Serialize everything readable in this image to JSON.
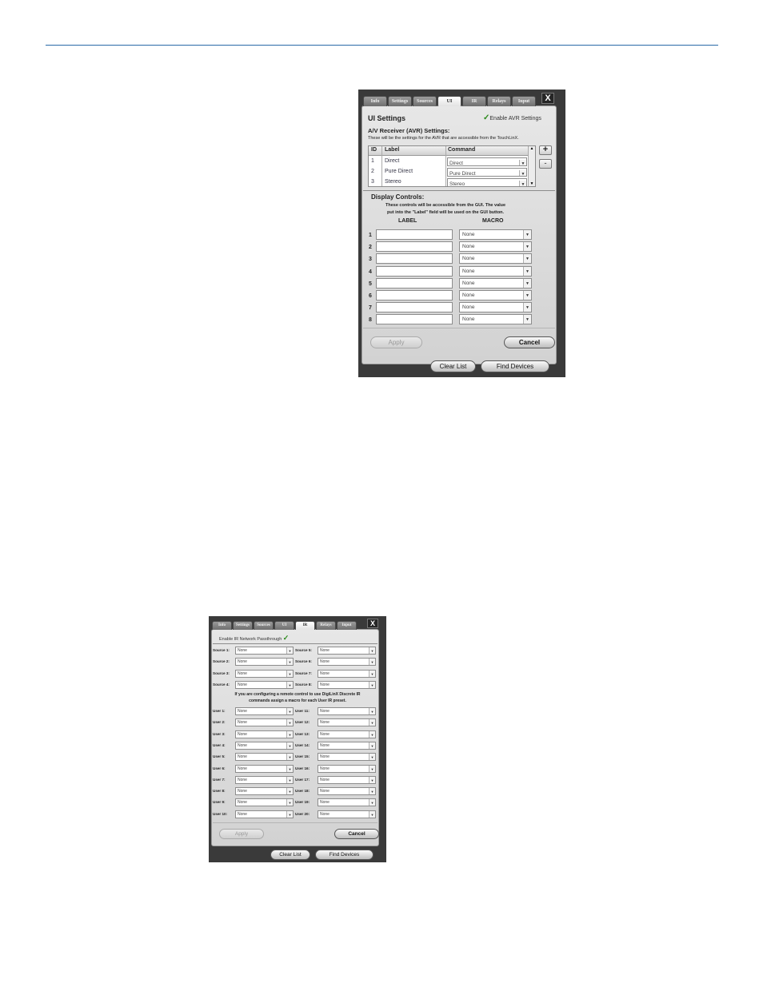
{
  "dialog1": {
    "tabs": [
      "Info",
      "Settings",
      "Sources",
      "UI",
      "IR",
      "Relays",
      "Input"
    ],
    "active_tab": "UI",
    "close": "X",
    "title": "UI Settings",
    "enable_avr": "Enable AVR Settings",
    "avr_heading": "A/V Receiver (AVR) Settings:",
    "avr_desc": "These will be the settings for the AVR that are accessible from the TouchLinX.",
    "columns": [
      "ID",
      "Label",
      "Command"
    ],
    "rows": [
      {
        "id": "1",
        "label": "Direct",
        "command": "Direct"
      },
      {
        "id": "2",
        "label": "Pure Direct",
        "command": "Pure Direct"
      },
      {
        "id": "3",
        "label": "Stereo",
        "command": "Stereo"
      }
    ],
    "add": "+",
    "remove": "-",
    "display_heading": "Display Controls:",
    "display_desc1": "These controls will be accessible from the GUI.  The value",
    "display_desc2": "put into the \"Label\" field will be used on the GUI button.",
    "label_col": "LABEL",
    "macro_col": "MACRO",
    "controls": [
      {
        "n": "1",
        "macro": "None"
      },
      {
        "n": "2",
        "macro": "None"
      },
      {
        "n": "3",
        "macro": "None"
      },
      {
        "n": "4",
        "macro": "None"
      },
      {
        "n": "5",
        "macro": "None"
      },
      {
        "n": "6",
        "macro": "None"
      },
      {
        "n": "7",
        "macro": "None"
      },
      {
        "n": "8",
        "macro": "None"
      }
    ],
    "apply": "Apply",
    "cancel": "Cancel",
    "clear_list": "Clear List",
    "find_devices": "Find Devices"
  },
  "dialog2": {
    "tabs": [
      "Info",
      "Settings",
      "Sources",
      "UI",
      "IR",
      "Relays",
      "Input"
    ],
    "active_tab": "IR",
    "close": "X",
    "passthrough": "Enable IR Network Passthrough",
    "sources_left": [
      {
        "label": "Source 1:",
        "value": "None"
      },
      {
        "label": "Source 2:",
        "value": "None"
      },
      {
        "label": "Source 3:",
        "value": "None"
      },
      {
        "label": "Source 4:",
        "value": "None"
      }
    ],
    "sources_right": [
      {
        "label": "Source 5:",
        "value": "None"
      },
      {
        "label": "Source 6:",
        "value": "None"
      },
      {
        "label": "Source 7:",
        "value": "None"
      },
      {
        "label": "Source 8:",
        "value": "None"
      }
    ],
    "note1": "If you are configuring a remote control to use DigiLinX Discrete IR",
    "note2": "commands assign a macro for each User IR preset.",
    "users_left": [
      {
        "label": "User 1:",
        "value": "None"
      },
      {
        "label": "User 2:",
        "value": "None"
      },
      {
        "label": "User 3:",
        "value": "None"
      },
      {
        "label": "User 4:",
        "value": "None"
      },
      {
        "label": "User 5:",
        "value": "None"
      },
      {
        "label": "User 6:",
        "value": "None"
      },
      {
        "label": "User 7:",
        "value": "None"
      },
      {
        "label": "User 8:",
        "value": "None"
      },
      {
        "label": "User 9:",
        "value": "None"
      },
      {
        "label": "User 10:",
        "value": "None"
      }
    ],
    "users_right": [
      {
        "label": "User 11:",
        "value": "None"
      },
      {
        "label": "User 12:",
        "value": "None"
      },
      {
        "label": "User 13:",
        "value": "None"
      },
      {
        "label": "User 14:",
        "value": "None"
      },
      {
        "label": "User 15:",
        "value": "None"
      },
      {
        "label": "User 16:",
        "value": "None"
      },
      {
        "label": "User 17:",
        "value": "None"
      },
      {
        "label": "User 18:",
        "value": "None"
      },
      {
        "label": "User 19:",
        "value": "None"
      },
      {
        "label": "User 20:",
        "value": "None"
      }
    ],
    "apply": "Apply",
    "cancel": "Cancel",
    "clear_list": "Clear List",
    "find_devices": "Find Devices"
  }
}
